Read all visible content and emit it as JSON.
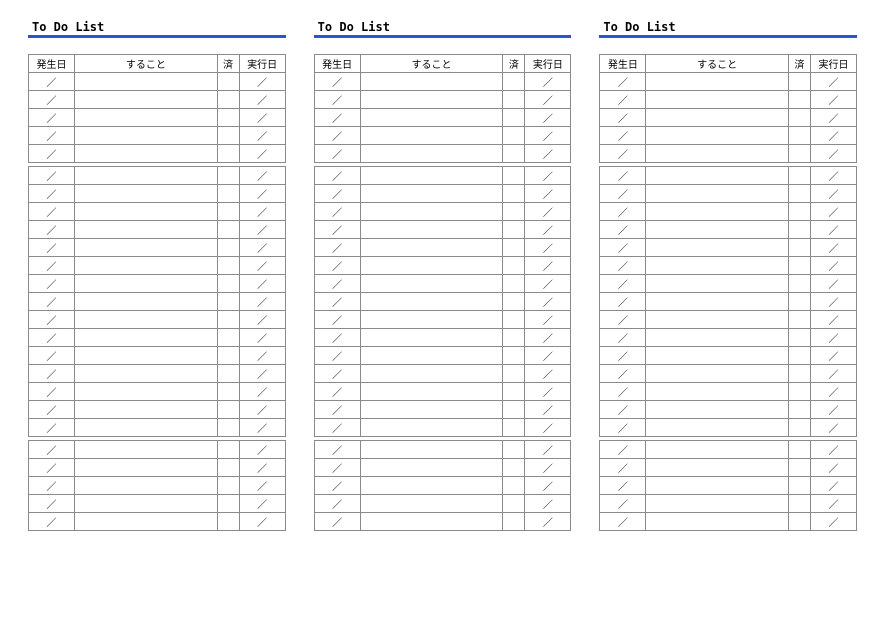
{
  "title": "To Do List",
  "columns": {
    "date_col": "発生日",
    "task_col": "すること",
    "done_col": "済",
    "exec_col": "実行日"
  },
  "slash": "／",
  "panel_count": 3,
  "groups": [
    5,
    15,
    5
  ]
}
